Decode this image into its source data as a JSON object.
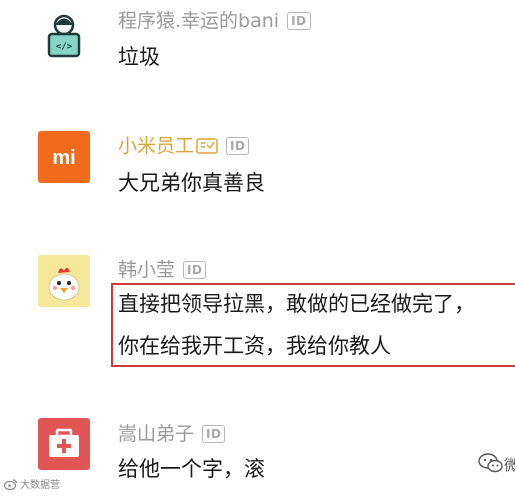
{
  "colors": {
    "vip_name": "#d8a53a",
    "name": "#9a9a9a",
    "highlight_border": "#cf3a3a",
    "xiaomi_orange": "#f26b1d",
    "medical_red": "#e25555",
    "coder_teal": "#86d3c8"
  },
  "comments": [
    {
      "avatar_icon": "programmer-avatar-icon",
      "avatar_text": "</>",
      "username": "程序猿.幸运的bani",
      "id_badge": "ID",
      "text": "垃圾"
    },
    {
      "avatar_icon": "xiaomi-logo-icon",
      "avatar_text": "mi",
      "username": "小米员工",
      "verified_icon": "verified-badge-icon",
      "id_badge": "ID",
      "text": "大兄弟你真善良"
    },
    {
      "avatar_icon": "chicken-avatar-icon",
      "username": "韩小莹",
      "id_badge": "ID",
      "text_lines": [
        "直接把领导拉黑，敢做的已经做完了，",
        "你在给我开工资，我给你教人"
      ]
    },
    {
      "avatar_icon": "first-aid-kit-icon",
      "username": "嵩山弟子",
      "id_badge": "ID",
      "text": "给他一个字，滚"
    }
  ],
  "watermark": {
    "left_icon": "weibo-icon",
    "left_text": "大数据营",
    "right_icon": "wechat-icon",
    "right_text": "微"
  }
}
